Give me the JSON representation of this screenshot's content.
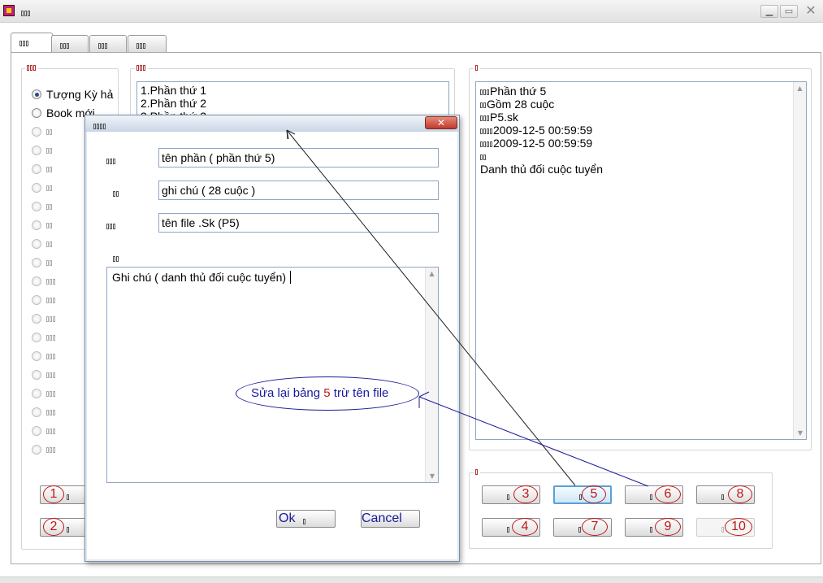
{
  "app": {
    "title_icon": "app-icon"
  },
  "categories": {
    "items": [
      {
        "label": "Tượng Kỳ hả",
        "checked": true
      },
      {
        "label": "Book mới",
        "checked": false
      }
    ]
  },
  "parts_list": {
    "items": [
      "1.Phần thứ 1",
      "2.Phần thứ 2",
      "3.Phần thứ 3"
    ]
  },
  "details": {
    "lines": [
      "Phần thứ 5",
      "Gồm 28 cuộc",
      "P5.sk",
      "2009-12-5 00:59:59",
      "2009-12-5 00:59:59",
      "",
      "Danh thủ đối cuộc tuyển"
    ]
  },
  "left_buttons": {
    "numbers": [
      "1",
      "2"
    ]
  },
  "right_buttons": {
    "numbers": [
      "3",
      "5",
      "6",
      "8",
      "4",
      "7",
      "9",
      "10"
    ]
  },
  "dialog": {
    "field_name": "tên phần ( phần thứ 5)",
    "field_note": "ghi chú ( 28 cuộc )",
    "field_file": "tên file .Sk (P5)",
    "memo_text": "Ghi chú ( danh thủ đối cuộc tuyển)",
    "ok_label": "Ok",
    "cancel_label": "Cancel",
    "close_label": "✕"
  },
  "annotation": {
    "text_before": "Sửa lại bảng",
    "number": "5",
    "text_after": "trừ tên file"
  },
  "colors": {
    "annotation_blue": "#1a1a9a",
    "annotation_red": "#c01818",
    "focus_border": "#5aa0d8"
  }
}
